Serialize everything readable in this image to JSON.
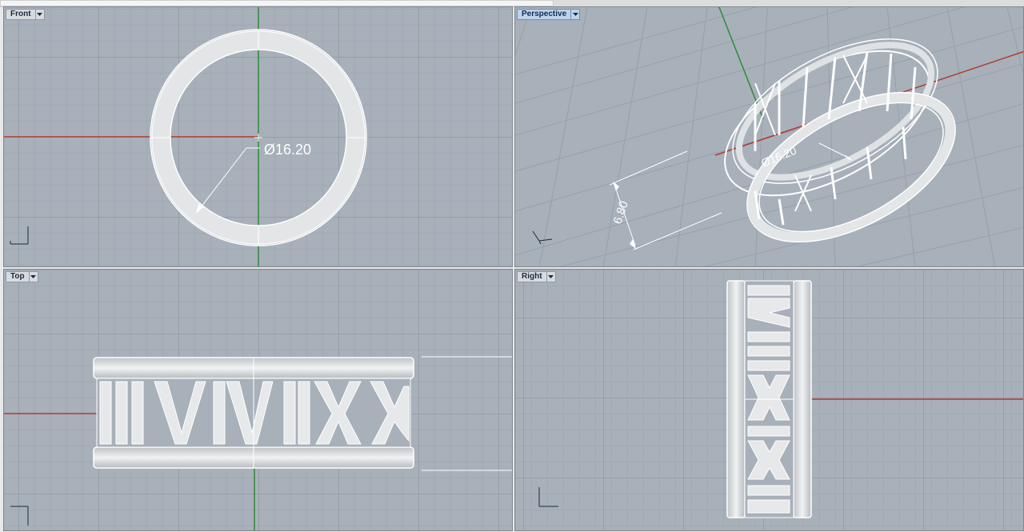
{
  "viewports": {
    "front": {
      "title": "Front",
      "dimension_label": "Ø16.20"
    },
    "perspective": {
      "title": "Perspective",
      "diameter_label": "Ø16.20",
      "width_label": "6.80"
    },
    "top": {
      "title": "Top"
    },
    "right": {
      "title": "Right"
    }
  },
  "colors": {
    "viewport_bg": "#a8b0ba",
    "grid_minor": "#9aa3ad",
    "grid_major": "#8a929c",
    "x_axis": "#b03a2e",
    "y_axis": "#2e8b3a",
    "model_fill": "#e4e6e8",
    "model_edge": "#ffffff",
    "active_title_bg": "#bcd3ea"
  },
  "icons": [
    "dropdown-arrow-icon",
    "axis-gizmo-icon"
  ]
}
